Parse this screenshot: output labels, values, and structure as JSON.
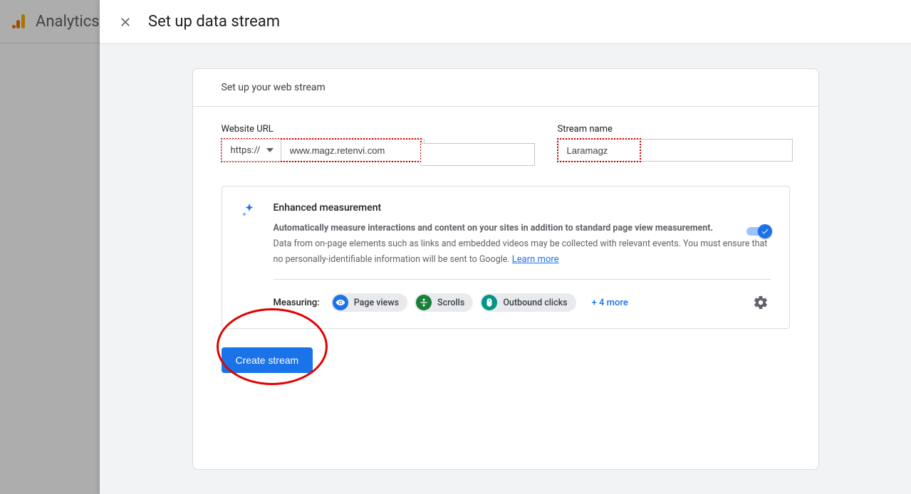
{
  "background": {
    "product_name": "Analytics"
  },
  "panel": {
    "title": "Set up data stream"
  },
  "card": {
    "header": "Set up your web stream",
    "website_url_label": "Website URL",
    "protocol_value": "https://",
    "url_value": "www.magz.retenvi.com",
    "stream_name_label": "Stream name",
    "stream_name_value": "Laramagz"
  },
  "enhanced": {
    "title": "Enhanced measurement",
    "bold_line": "Automatically measure interactions and content on your sites in addition to standard page view measurement.",
    "desc_line": "Data from on-page elements such as links and embedded videos may be collected with relevant events. You must ensure that no personally-identifiable information will be sent to Google. ",
    "learn_more": "Learn more",
    "measuring_label": "Measuring:",
    "chips": {
      "page_views": "Page views",
      "scrolls": "Scrolls",
      "outbound": "Outbound clicks"
    },
    "more": "+ 4 more"
  },
  "actions": {
    "create_stream": "Create stream"
  }
}
